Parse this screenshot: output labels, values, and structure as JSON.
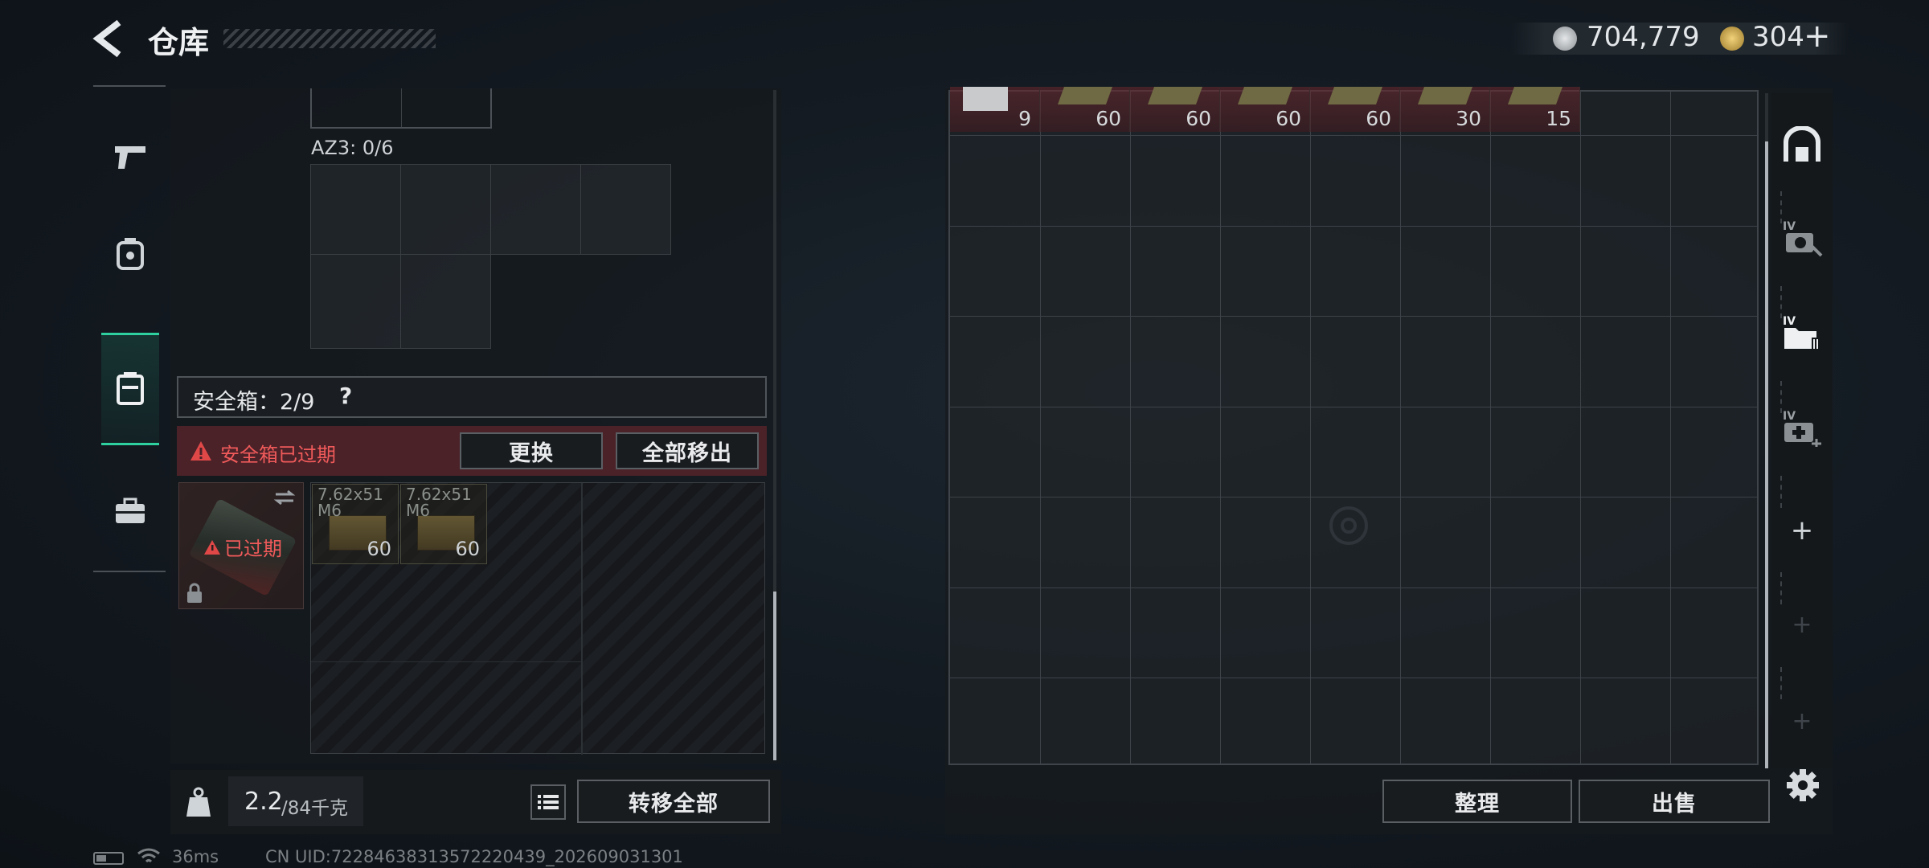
{
  "header": {
    "title": "仓库",
    "silver": "704,779",
    "gold": "304",
    "add_symbol": "+"
  },
  "left_nav": {
    "items": [
      "weapons",
      "armor",
      "safebox",
      "toolbox"
    ],
    "active": 2
  },
  "container": {
    "az3_label": "AZ3: 0/6"
  },
  "safebox": {
    "label": "安全箱：2/9",
    "help": "?",
    "expired_notice": "安全箱已过期",
    "replace_button": "更换",
    "remove_all_button": "全部移出",
    "expired_tag": "已过期",
    "items": [
      {
        "name": "7.62x51",
        "sub": "M6",
        "qty": "60"
      },
      {
        "name": "7.62x51",
        "sub": "M6",
        "qty": "60"
      }
    ]
  },
  "footer_left": {
    "weight": "2.2",
    "weight_max": "/84千克",
    "transfer_all": "转移全部"
  },
  "stash": {
    "top_row_qty": [
      "9",
      "60",
      "60",
      "60",
      "60",
      "30",
      "15"
    ],
    "sort_button": "整理",
    "sell_button": "出售"
  },
  "right_tabs": [
    "stash-tab",
    "iv-tab-1",
    "iv-tab-2",
    "iv-tab-3",
    "add-tab"
  ],
  "status_bar": {
    "ping": "36ms",
    "uid": "CN UID:72284638313572220439_202609031301"
  },
  "colors": {
    "accent": "#2fd0a0",
    "danger": "#e04848",
    "danger_bg": "#5a2a30"
  }
}
